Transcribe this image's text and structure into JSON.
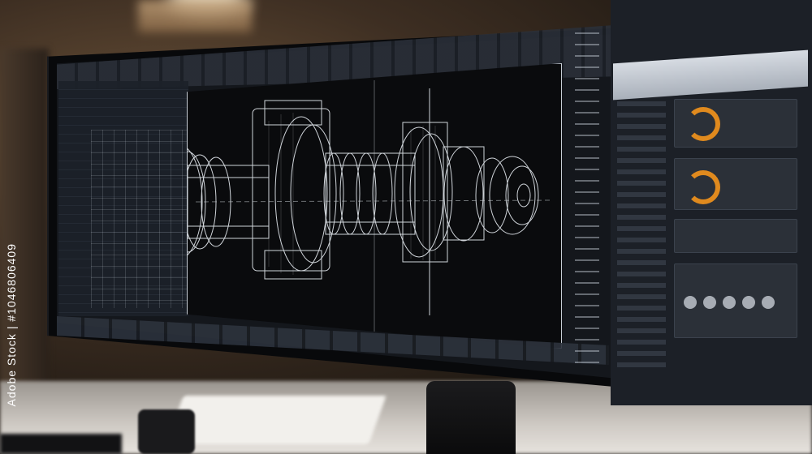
{
  "scene": {
    "watermark_side": "Adobe Stock | #1046806409"
  },
  "cad_app": {
    "viewport_model": "wireframe-mechanical-shaft",
    "icons": [
      "viewport-wireframe",
      "orange-progress-ring-icon",
      "orange-progress-ring-icon"
    ]
  },
  "colors": {
    "accent": "#e08a1e",
    "wireframe": "#e6ebf1",
    "screen_bg": "#0a0b0d"
  }
}
